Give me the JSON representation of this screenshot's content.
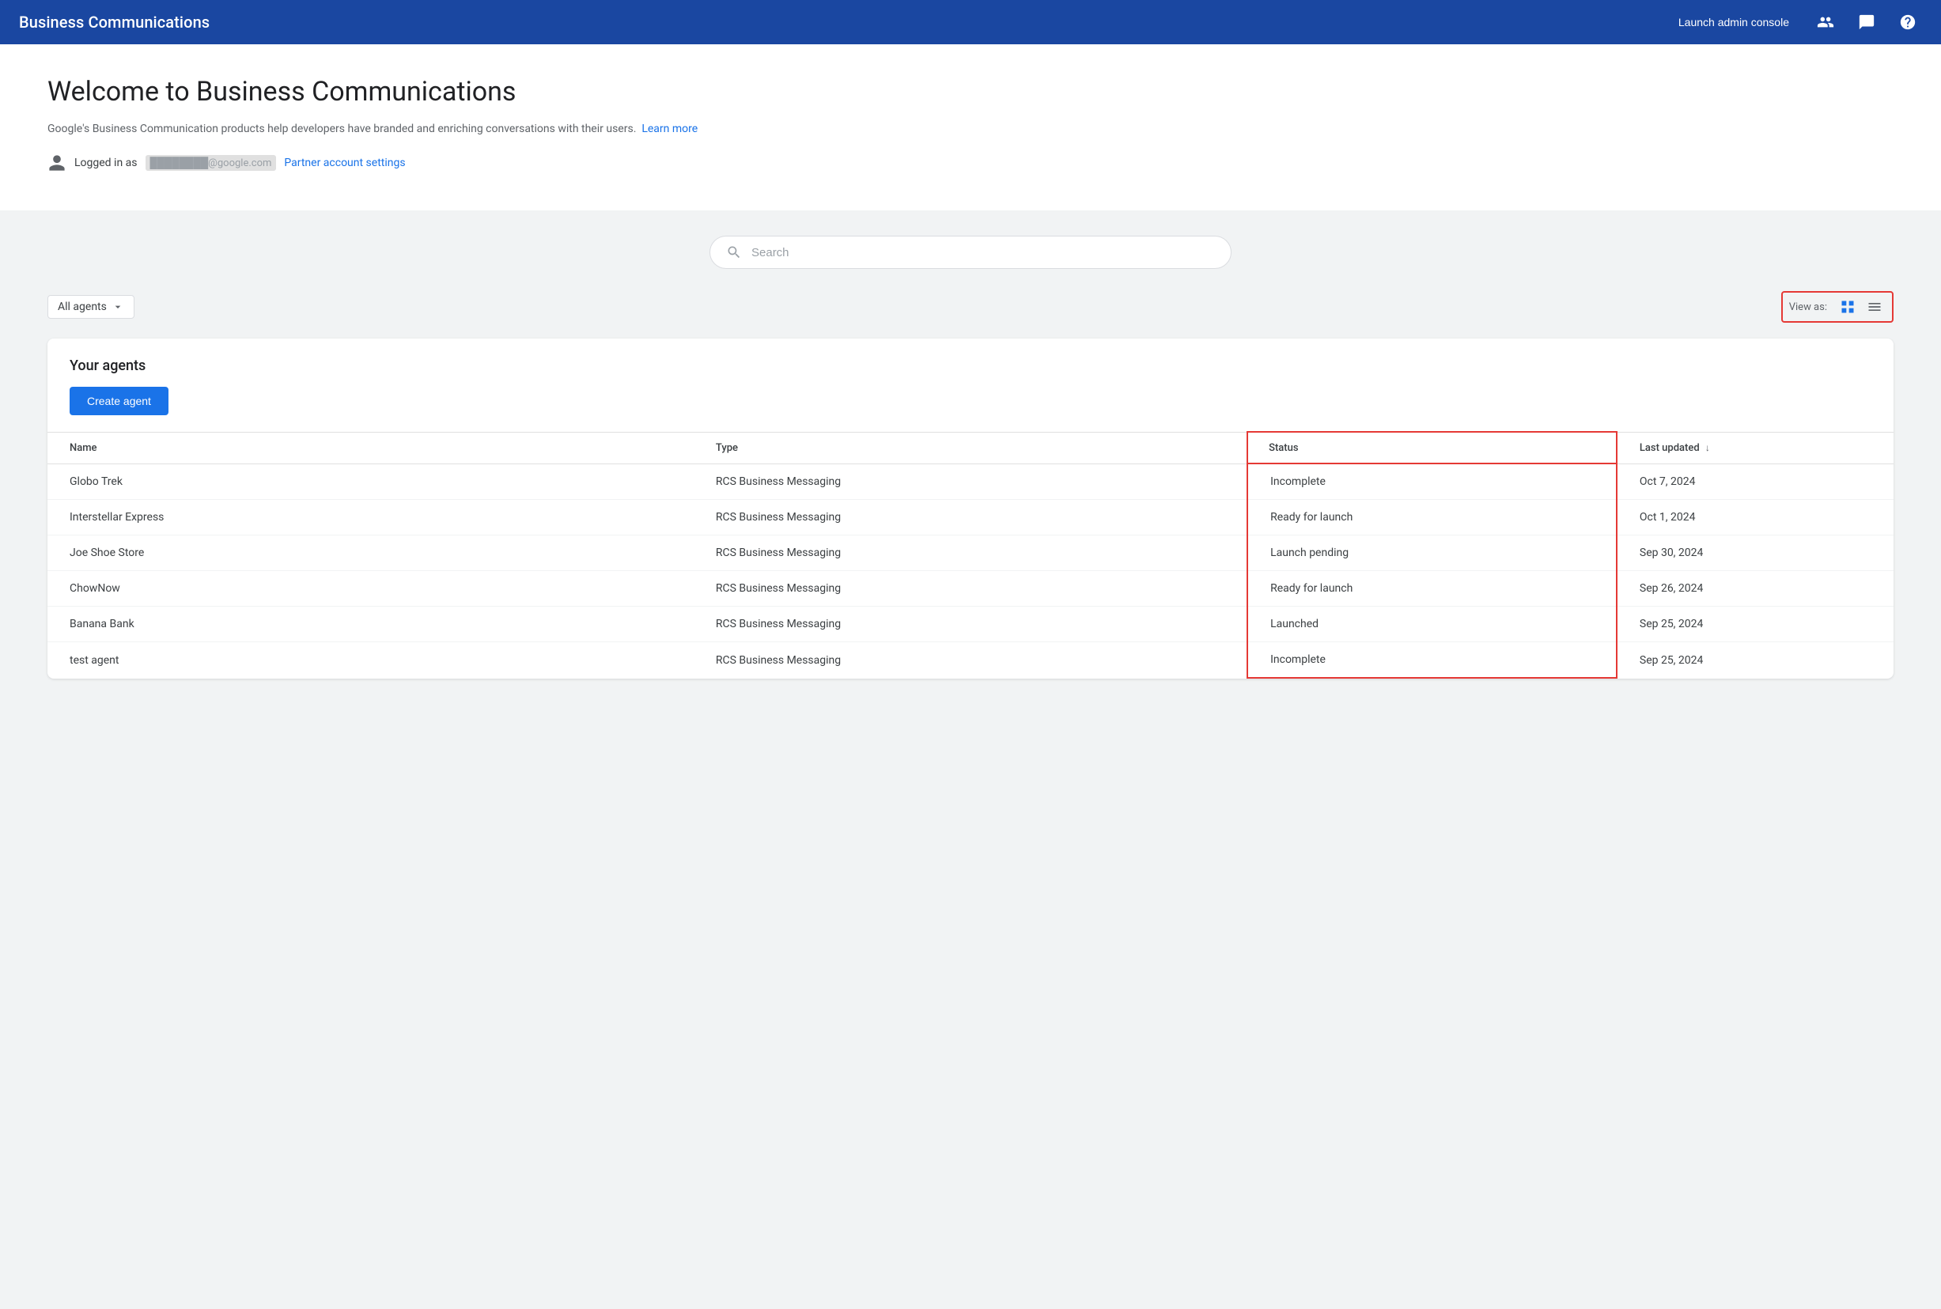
{
  "header": {
    "title": "Business Communications",
    "launch_btn": "Launch admin console",
    "icons": {
      "people": "👥",
      "chat": "💬",
      "help": "?"
    }
  },
  "hero": {
    "title": "Welcome to Business Communications",
    "description": "Google's Business Communication products help developers have branded and enriching conversations with their users.",
    "learn_more": "Learn more",
    "logged_in_as": "Logged in as",
    "email_placeholder": "████████@google.com",
    "partner_settings_link": "Partner account settings"
  },
  "search": {
    "placeholder": "Search"
  },
  "filter": {
    "all_agents": "All agents",
    "view_as_label": "View as:"
  },
  "agents": {
    "section_title": "Your agents",
    "create_button": "Create agent",
    "columns": {
      "name": "Name",
      "type": "Type",
      "status": "Status",
      "last_updated": "Last updated"
    },
    "rows": [
      {
        "name": "Globo Trek",
        "type": "RCS Business Messaging",
        "status": "Incomplete",
        "last_updated": "Oct 7, 2024"
      },
      {
        "name": "Interstellar Express",
        "type": "RCS Business Messaging",
        "status": "Ready for launch",
        "last_updated": "Oct 1, 2024"
      },
      {
        "name": "Joe Shoe Store",
        "type": "RCS Business Messaging",
        "status": "Launch pending",
        "last_updated": "Sep 30, 2024"
      },
      {
        "name": "ChowNow",
        "type": "RCS Business Messaging",
        "status": "Ready for launch",
        "last_updated": "Sep 26, 2024"
      },
      {
        "name": "Banana Bank",
        "type": "RCS Business Messaging",
        "status": "Launched",
        "last_updated": "Sep 25, 2024"
      },
      {
        "name": "test agent",
        "type": "RCS Business Messaging",
        "status": "Incomplete",
        "last_updated": "Sep 25, 2024"
      }
    ]
  }
}
